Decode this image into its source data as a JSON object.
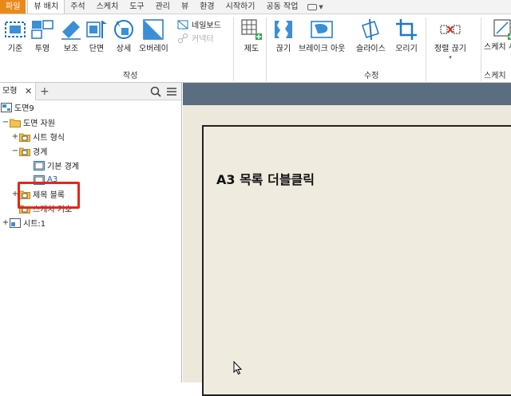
{
  "menu": {
    "tabs": [
      "파일",
      "뷰 배치",
      "주석",
      "스케치",
      "도구",
      "관리",
      "뷰",
      "환경",
      "시작하기",
      "공동 작업"
    ],
    "active": "뷰 배치"
  },
  "ribbon": {
    "create_buttons": [
      "기준",
      "투영",
      "보조",
      "단면",
      "상세",
      "오버레이"
    ],
    "small_buttons": [
      {
        "label": "네일보드",
        "enabled": true
      },
      {
        "label": "커넥터",
        "enabled": false
      }
    ],
    "group_create": "작성",
    "modify_buttons": [
      "제도",
      "끊기",
      "브레이크 아웃",
      "슬라이스",
      "오리기",
      "정렬 끊기",
      "스케치 시작"
    ],
    "group_modify": "수정",
    "group_sketch": "스케치",
    "sketch_button_line2": "시작"
  },
  "panel": {
    "tab_label": "모형",
    "tree": [
      {
        "label": "도면9",
        "level": 0
      },
      {
        "label": "도면 자원",
        "level": 1
      },
      {
        "label": "시트 형식",
        "level": 2
      },
      {
        "label": "경계",
        "level": 2
      },
      {
        "label": "기본 경계",
        "level": 3
      },
      {
        "label": "A3",
        "level": 3,
        "selected": true
      },
      {
        "label": "제목 블록",
        "level": 2
      },
      {
        "label": "스케치 기호",
        "level": 2
      },
      {
        "label": "시트:1",
        "level": 0
      }
    ]
  },
  "canvas": {
    "annotation": "A3 목록 더블클릭"
  },
  "colors": {
    "file_tab": "#e9891a",
    "highlight": "#e62617",
    "canvas_header": "#5b6d80",
    "sheet_bg": "#ece8dc",
    "selection_text": "#1a5fb4"
  }
}
